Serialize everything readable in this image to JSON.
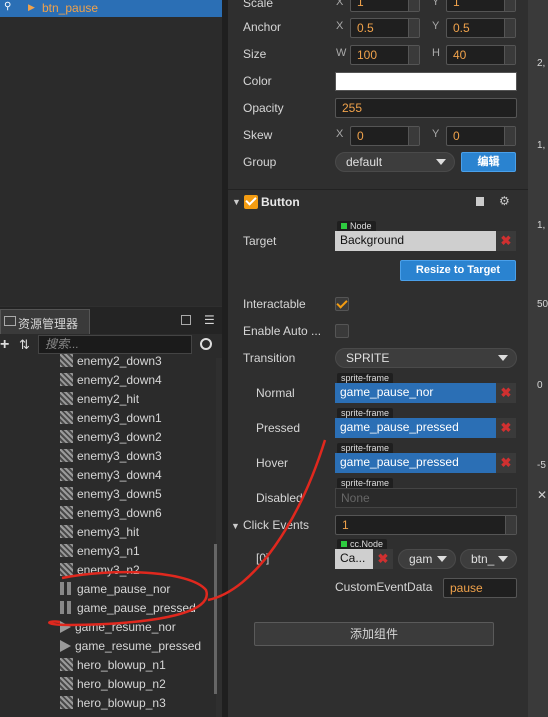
{
  "hierarchy": {
    "selected_node": "btn_pause"
  },
  "assets": {
    "tab_label": "资源管理器",
    "search_placeholder": "搜索...",
    "items": [
      {
        "name": "enemy2_down3",
        "icon": "sprite-frame-icon"
      },
      {
        "name": "enemy2_down4",
        "icon": "sprite-frame-icon"
      },
      {
        "name": "enemy2_hit",
        "icon": "sprite-frame-icon"
      },
      {
        "name": "enemy3_down1",
        "icon": "sprite-frame-icon"
      },
      {
        "name": "enemy3_down2",
        "icon": "sprite-frame-icon"
      },
      {
        "name": "enemy3_down3",
        "icon": "sprite-frame-icon"
      },
      {
        "name": "enemy3_down4",
        "icon": "sprite-frame-icon"
      },
      {
        "name": "enemy3_down5",
        "icon": "sprite-frame-icon"
      },
      {
        "name": "enemy3_down6",
        "icon": "sprite-frame-icon"
      },
      {
        "name": "enemy3_hit",
        "icon": "sprite-frame-icon"
      },
      {
        "name": "enemy3_n1",
        "icon": "sprite-frame-icon"
      },
      {
        "name": "enemy3_n2",
        "icon": "sprite-frame-icon"
      },
      {
        "name": "game_pause_nor",
        "icon": "pause-sprite-icon"
      },
      {
        "name": "game_pause_pressed",
        "icon": "pause-sprite-icon"
      },
      {
        "name": "game_resume_nor",
        "icon": "play-sprite-icon"
      },
      {
        "name": "game_resume_pressed",
        "icon": "play-sprite-icon"
      },
      {
        "name": "hero_blowup_n1",
        "icon": "sprite-frame-icon"
      },
      {
        "name": "hero_blowup_n2",
        "icon": "sprite-frame-icon"
      },
      {
        "name": "hero_blowup_n3",
        "icon": "sprite-frame-icon"
      }
    ]
  },
  "inspector": {
    "scale": {
      "label": "Scale",
      "x_axis": "X",
      "x": "1",
      "y_axis": "Y",
      "y": "1"
    },
    "anchor": {
      "label": "Anchor",
      "x_axis": "X",
      "x": "0.5",
      "y_axis": "Y",
      "y": "0.5"
    },
    "size": {
      "label": "Size",
      "w_axis": "W",
      "w": "100",
      "h_axis": "H",
      "h": "40"
    },
    "color": {
      "label": "Color",
      "value": "#ffffff"
    },
    "opacity": {
      "label": "Opacity",
      "value": "255"
    },
    "skew": {
      "label": "Skew",
      "x_axis": "X",
      "x": "0",
      "y_axis": "Y",
      "y": "0"
    },
    "group": {
      "label": "Group",
      "value": "default",
      "edit_button": "编辑"
    },
    "button_component": {
      "title": "Button",
      "target": {
        "label": "Target",
        "tag": "Node",
        "value": "Background"
      },
      "resize_button": "Resize to Target",
      "interactable": {
        "label": "Interactable",
        "checked": true
      },
      "enable_auto": {
        "label": "Enable Auto ...",
        "checked": false
      },
      "transition": {
        "label": "Transition",
        "value": "SPRITE"
      },
      "normal": {
        "label": "Normal",
        "tag": "sprite-frame",
        "value": "game_pause_nor"
      },
      "pressed": {
        "label": "Pressed",
        "tag": "sprite-frame",
        "value": "game_pause_pressed"
      },
      "hover": {
        "label": "Hover",
        "tag": "sprite-frame",
        "value": "game_pause_pressed"
      },
      "disabled": {
        "label": "Disabled",
        "tag": "sprite-frame",
        "value": "None"
      },
      "click_events": {
        "label": "Click Events",
        "count": "1",
        "index_label": "[0]",
        "node_tag": "cc.Node",
        "node_value": "Ca...",
        "component_value": "gam",
        "handler_value": "btn_",
        "custom_data_label": "CustomEventData",
        "custom_data_value": "pause"
      }
    },
    "add_component_button": "添加组件"
  },
  "scene_ruler": {
    "ticks": [
      "2,",
      "1,",
      "1,",
      "50",
      "0",
      "-5"
    ]
  },
  "colors": {
    "accent": "#2b6fb5",
    "value_orange": "#f0a24b",
    "check_orange": "#f39c12",
    "annotation_red": "#e0281e"
  }
}
